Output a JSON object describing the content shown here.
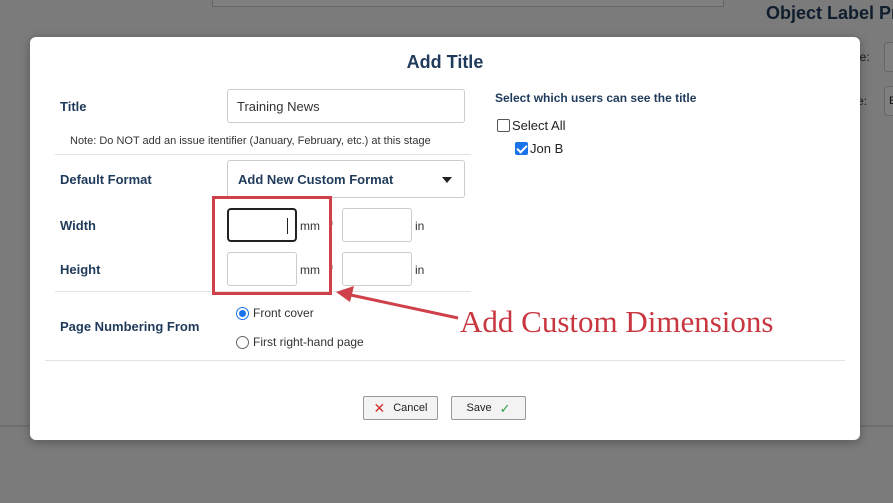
{
  "background": {
    "object_label_text": "Object Label Pro",
    "field_label_1": "le:",
    "field_label_2": "e:",
    "field_value_2": "E"
  },
  "modal": {
    "title": "Add Title",
    "title_field": {
      "label": "Title",
      "value": "Training News",
      "note": "Note: Do NOT add an issue itentifier (January, February, etc.) at this stage"
    },
    "default_format": {
      "label": "Default Format",
      "selected": "Add New Custom Format"
    },
    "width": {
      "label": "Width",
      "mm_value": "",
      "mm_unit": "mm",
      "in_value": "",
      "in_unit": "in"
    },
    "height": {
      "label": "Height",
      "mm_value": "",
      "mm_unit": "mm",
      "in_value": "",
      "in_unit": "in"
    },
    "page_numbering": {
      "label": "Page Numbering From",
      "options": [
        {
          "label": "Front cover",
          "selected": true
        },
        {
          "label": "First right-hand page",
          "selected": false
        }
      ]
    },
    "users": {
      "title": "Select which users can see the title",
      "select_all": {
        "label": "Select All",
        "checked": false
      },
      "list": [
        {
          "label": "Jon B",
          "checked": true
        }
      ]
    },
    "buttons": {
      "cancel": "Cancel",
      "save": "Save"
    }
  },
  "annotation": {
    "text": "Add Custom Dimensions",
    "color": "#c8363f"
  }
}
